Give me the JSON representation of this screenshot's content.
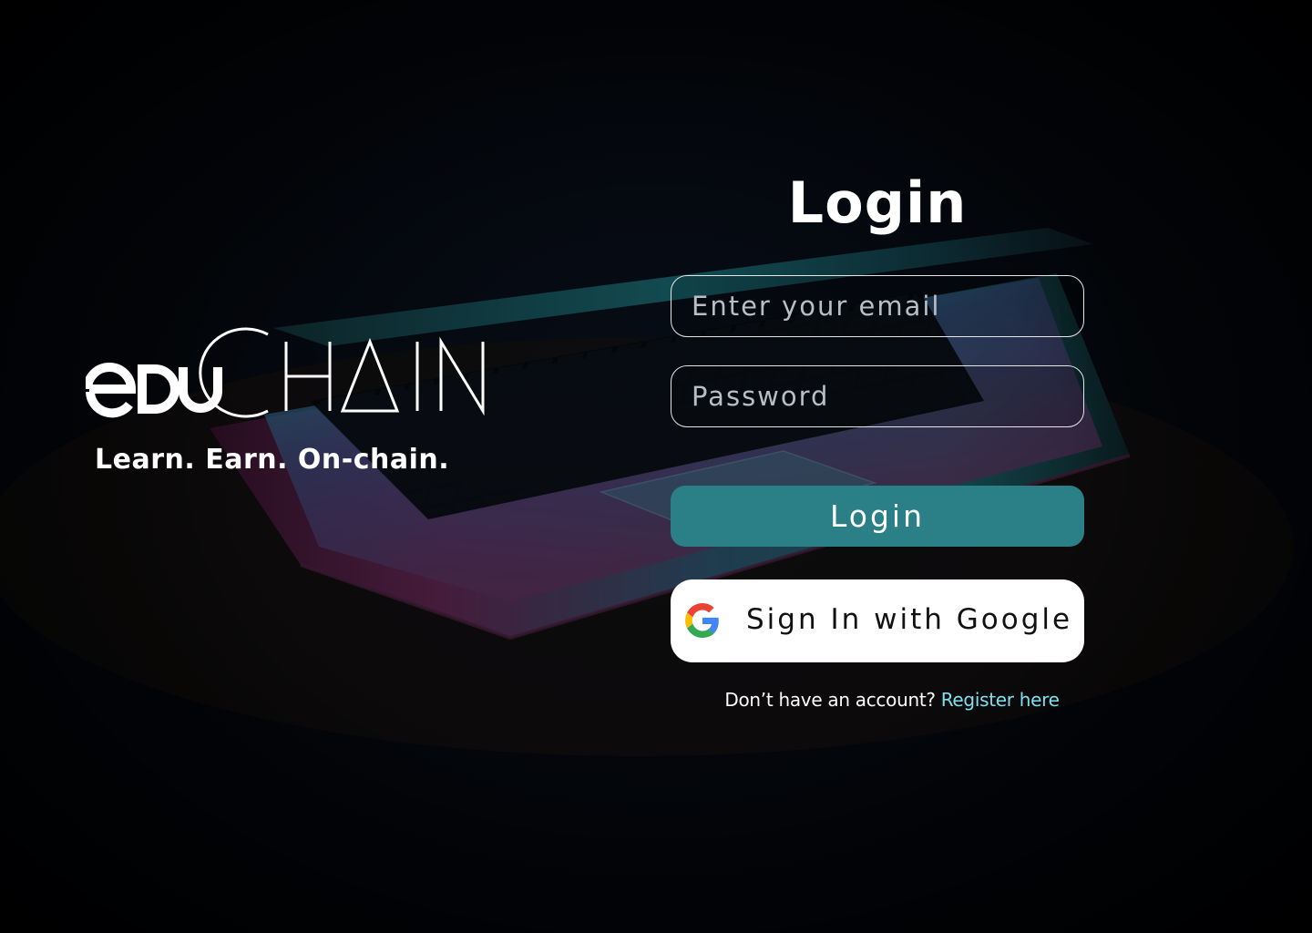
{
  "brand": {
    "logo_text": "eduCHAIN",
    "tagline": "Learn. Earn. On-chain."
  },
  "login": {
    "heading": "Login",
    "email_placeholder": "Enter your email",
    "password_placeholder": "Password",
    "login_button": "Login",
    "google_button": "Sign In with Google",
    "register_prompt": "Don’t have an account?",
    "register_link": "Register here"
  },
  "colors": {
    "background": "#03060b",
    "accent_teal": "#2b8087",
    "link": "#7ee0ef",
    "google_button_bg": "#ffffff"
  },
  "icons": {
    "google": "google-icon"
  }
}
